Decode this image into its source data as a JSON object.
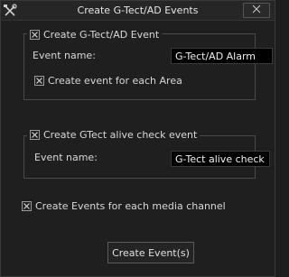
{
  "window": {
    "title": "Create G-Tect/AD Events",
    "app_icon": "tools-icon",
    "close_icon": "close-icon"
  },
  "gtect_ad_group": {
    "checkbox_label": "Create G-Tect/AD Event",
    "checked": true,
    "event_name_label": "Event name:",
    "event_name_value": "G-Tect/AD Alarm",
    "per_area_label": "Create event for each Area",
    "per_area_checked": true
  },
  "alive_group": {
    "checkbox_label": "Create GTect alive check event",
    "checked": true,
    "event_name_label": "Event name:",
    "event_name_value": "G-Tect alive check"
  },
  "media_channel": {
    "label": "Create Events for each media channel",
    "checked": true
  },
  "create_button": {
    "label": "Create Event(s)"
  },
  "colors": {
    "background": "#1f1f1f",
    "border": "#4a4a4a",
    "field_bg": "#000000",
    "text": "#d8d8d8"
  }
}
